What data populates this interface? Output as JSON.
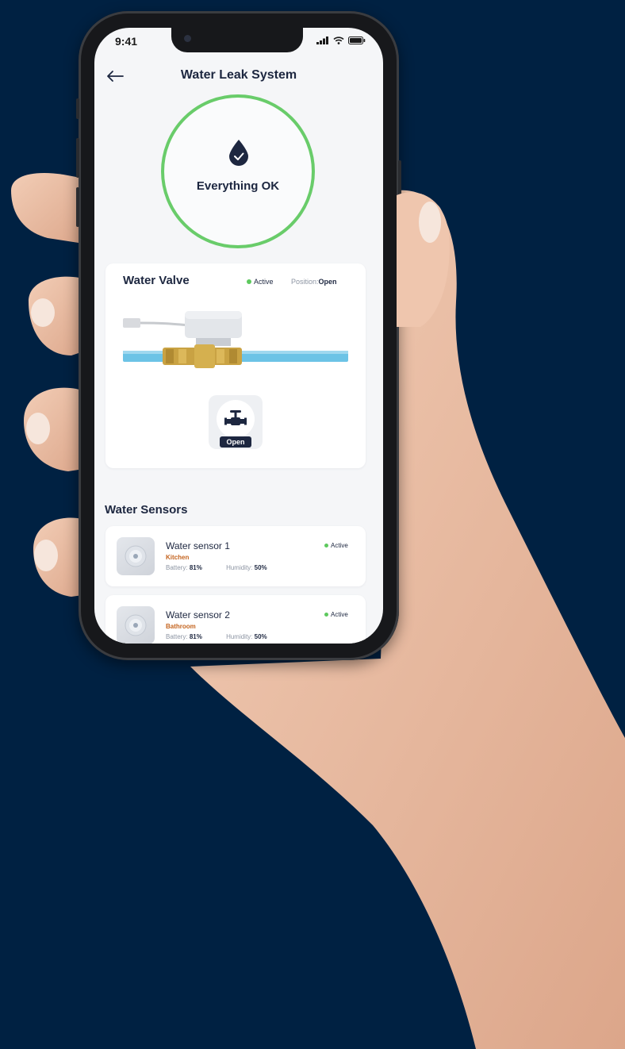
{
  "colors": {
    "background": "#002142",
    "accent_ok": "#69cc6a",
    "text_primary": "#1d2740",
    "room_label": "#c4641f",
    "pipe": "#6cc3e6"
  },
  "status_bar": {
    "time": "9:41",
    "icons": [
      "signal-icon",
      "wifi-icon",
      "battery-icon"
    ]
  },
  "header": {
    "back_icon": "arrow-left-icon",
    "title": "Water Leak System"
  },
  "system_status": {
    "icon": "water-drop-check-icon",
    "label": "Everything OK"
  },
  "valve": {
    "title": "Water Valve",
    "status": "Active",
    "position_label": "Position:",
    "position_value": "Open",
    "control_icon": "faucet-valve-icon",
    "control_label": "Open"
  },
  "sensors_section": {
    "title": "Water Sensors",
    "items": [
      {
        "name": "Water sensor 1",
        "room": "Kitchen",
        "status": "Active",
        "battery_label": "Battery:",
        "battery_value": "81%",
        "humidity_label": "Humidity:",
        "humidity_value": "50%"
      },
      {
        "name": "Water sensor 2",
        "room": "Bathroom",
        "status": "Active",
        "battery_label": "Battery:",
        "battery_value": "81%",
        "humidity_label": "Humidity:",
        "humidity_value": "50%"
      }
    ]
  }
}
